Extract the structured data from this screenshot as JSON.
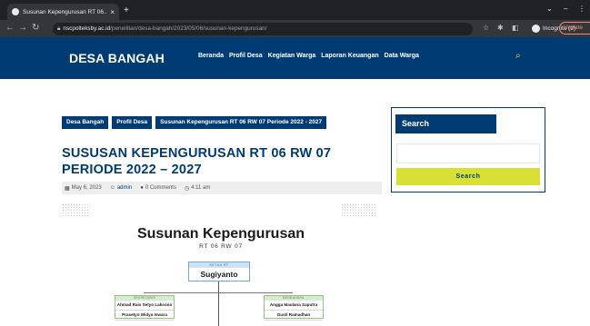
{
  "browser": {
    "tab_title": "Susunan Kepengurusan RT 06...",
    "tab_close": "×",
    "new_tab": "+",
    "url_host": "nscpolteksby.ac.id",
    "url_path": "/penelitian/desa-bangah/2023/05/06/susunan-kepengurusan/",
    "incognito_label": "Incognito (2)",
    "update_label": "Update"
  },
  "site": {
    "logo": "DESA BANGAH",
    "nav": [
      "Beranda",
      "Profil Desa",
      "Kegiatan Warga",
      "Laporan Keuangan",
      "Data Warga"
    ]
  },
  "breadcrumbs": [
    "Desa Bangah",
    "Profil Desa",
    "Susunan Kepengurusan RT 06 RW 07 Periode 2022 - 2027"
  ],
  "post": {
    "title": "SUSUSAN KEPENGURUSAN RT 06 RW 07 PERIODE 2022 – 2027",
    "date": "May 6, 2023",
    "author": "admin",
    "comments": "0 Comments",
    "time": "4:11 am"
  },
  "org_chart": {
    "title": "Susunan Kepengurusan",
    "subtitle": "RT 06 RW 07",
    "ketua_role": "KETUA RT",
    "ketua_name": "Sugiyanto",
    "left_role": "SEKRETARIS",
    "left_names": [
      "Ahmad Rais Setyo Laksono",
      "Prasetyo Widya Iswara"
    ],
    "right_role": "BENDAHARA",
    "right_names": [
      "Angga Maulana Saputra",
      "Gusti Ramadhan"
    ]
  },
  "sidebar": {
    "search_title": "Search",
    "search_button": "Search",
    "search_placeholder": ""
  },
  "colors": {
    "primary": "#003b73",
    "accent": "#d8e036",
    "header_search_icon": "#f2e433"
  }
}
